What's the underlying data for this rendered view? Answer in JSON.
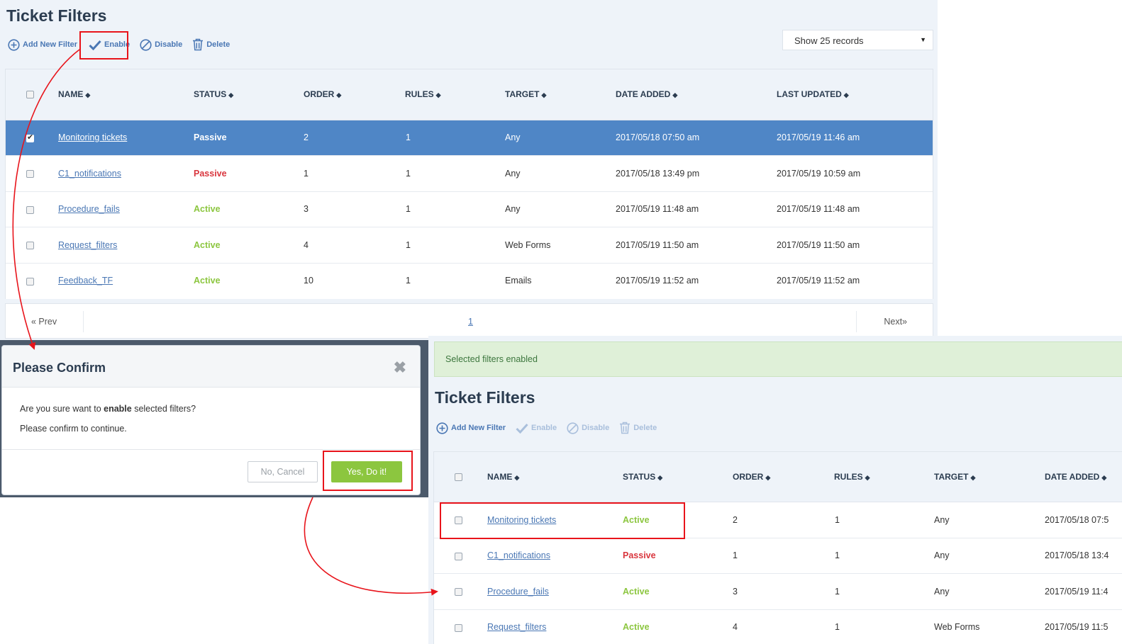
{
  "panel_before": {
    "title": "Ticket Filters",
    "toolbar": {
      "add_label": "Add New Filter",
      "enable_label": "Enable",
      "disable_label": "Disable",
      "delete_label": "Delete"
    },
    "records_select": "Show 25 records",
    "columns": [
      "NAME",
      "STATUS",
      "ORDER",
      "RULES",
      "TARGET",
      "DATE ADDED",
      "LAST UPDATED"
    ],
    "rows": [
      {
        "name": "Monitoring tickets",
        "status": "Passive",
        "order": "2",
        "rules": "1",
        "target": "Any",
        "date_added": "2017/05/18 07:50 am",
        "last_updated": "2017/05/19 11:46 am",
        "checked": true
      },
      {
        "name": "C1_notifications",
        "status": "Passive",
        "order": "1",
        "rules": "1",
        "target": "Any",
        "date_added": "2017/05/18 13:49 pm",
        "last_updated": "2017/05/19 10:59 am",
        "checked": false
      },
      {
        "name": "Procedure_fails",
        "status": "Active",
        "order": "3",
        "rules": "1",
        "target": "Any",
        "date_added": "2017/05/19 11:48 am",
        "last_updated": "2017/05/19 11:48 am",
        "checked": false
      },
      {
        "name": "Request_filters",
        "status": "Active",
        "order": "4",
        "rules": "1",
        "target": "Web Forms",
        "date_added": "2017/05/19 11:50 am",
        "last_updated": "2017/05/19 11:50 am",
        "checked": false
      },
      {
        "name": "Feedback_TF",
        "status": "Active",
        "order": "10",
        "rules": "1",
        "target": "Emails",
        "date_added": "2017/05/19 11:52 am",
        "last_updated": "2017/05/19 11:52 am",
        "checked": false
      }
    ],
    "pager": {
      "prev": "« Prev",
      "page": "1",
      "next": "Next»"
    }
  },
  "dialog": {
    "title": "Please Confirm",
    "close": "✖",
    "text_before": "Are you sure want to ",
    "text_bold": "enable",
    "text_after": " selected filters?",
    "text_line2": "Please confirm to continue.",
    "cancel_label": "No, Cancel",
    "confirm_label": "Yes, Do it!"
  },
  "panel_after": {
    "alert": "Selected filters enabled",
    "title": "Ticket Filters",
    "toolbar": {
      "add_label": "Add New Filter",
      "enable_label": "Enable",
      "disable_label": "Disable",
      "delete_label": "Delete"
    },
    "columns": [
      "NAME",
      "STATUS",
      "ORDER",
      "RULES",
      "TARGET",
      "DATE ADDED"
    ],
    "rows": [
      {
        "name": "Monitoring tickets",
        "status": "Active",
        "order": "2",
        "rules": "1",
        "target": "Any",
        "date_added": "2017/05/18 07:5"
      },
      {
        "name": "C1_notifications",
        "status": "Passive",
        "order": "1",
        "rules": "1",
        "target": "Any",
        "date_added": "2017/05/18 13:4"
      },
      {
        "name": "Procedure_fails",
        "status": "Active",
        "order": "3",
        "rules": "1",
        "target": "Any",
        "date_added": "2017/05/19 11:4"
      },
      {
        "name": "Request_filters",
        "status": "Active",
        "order": "4",
        "rules": "1",
        "target": "Web Forms",
        "date_added": "2017/05/19 11:5"
      }
    ]
  },
  "colors": {
    "accent": "#4f86c6",
    "link": "#4a77b4",
    "active": "#8cc63f",
    "passive": "#d9363e",
    "annotation": "#e8141b"
  }
}
